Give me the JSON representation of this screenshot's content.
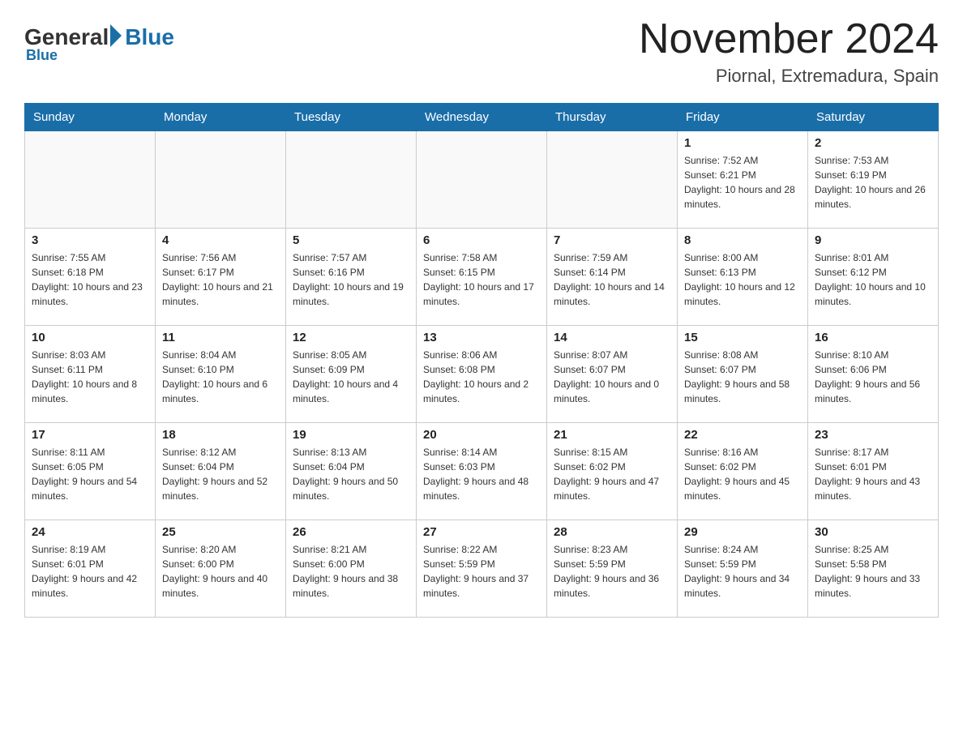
{
  "header": {
    "logo_general": "General",
    "logo_blue": "Blue",
    "title": "November 2024",
    "location": "Piornal, Extremadura, Spain"
  },
  "days_of_week": [
    "Sunday",
    "Monday",
    "Tuesday",
    "Wednesday",
    "Thursday",
    "Friday",
    "Saturday"
  ],
  "weeks": [
    [
      {
        "day": "",
        "info": ""
      },
      {
        "day": "",
        "info": ""
      },
      {
        "day": "",
        "info": ""
      },
      {
        "day": "",
        "info": ""
      },
      {
        "day": "",
        "info": ""
      },
      {
        "day": "1",
        "info": "Sunrise: 7:52 AM\nSunset: 6:21 PM\nDaylight: 10 hours and 28 minutes."
      },
      {
        "day": "2",
        "info": "Sunrise: 7:53 AM\nSunset: 6:19 PM\nDaylight: 10 hours and 26 minutes."
      }
    ],
    [
      {
        "day": "3",
        "info": "Sunrise: 7:55 AM\nSunset: 6:18 PM\nDaylight: 10 hours and 23 minutes."
      },
      {
        "day": "4",
        "info": "Sunrise: 7:56 AM\nSunset: 6:17 PM\nDaylight: 10 hours and 21 minutes."
      },
      {
        "day": "5",
        "info": "Sunrise: 7:57 AM\nSunset: 6:16 PM\nDaylight: 10 hours and 19 minutes."
      },
      {
        "day": "6",
        "info": "Sunrise: 7:58 AM\nSunset: 6:15 PM\nDaylight: 10 hours and 17 minutes."
      },
      {
        "day": "7",
        "info": "Sunrise: 7:59 AM\nSunset: 6:14 PM\nDaylight: 10 hours and 14 minutes."
      },
      {
        "day": "8",
        "info": "Sunrise: 8:00 AM\nSunset: 6:13 PM\nDaylight: 10 hours and 12 minutes."
      },
      {
        "day": "9",
        "info": "Sunrise: 8:01 AM\nSunset: 6:12 PM\nDaylight: 10 hours and 10 minutes."
      }
    ],
    [
      {
        "day": "10",
        "info": "Sunrise: 8:03 AM\nSunset: 6:11 PM\nDaylight: 10 hours and 8 minutes."
      },
      {
        "day": "11",
        "info": "Sunrise: 8:04 AM\nSunset: 6:10 PM\nDaylight: 10 hours and 6 minutes."
      },
      {
        "day": "12",
        "info": "Sunrise: 8:05 AM\nSunset: 6:09 PM\nDaylight: 10 hours and 4 minutes."
      },
      {
        "day": "13",
        "info": "Sunrise: 8:06 AM\nSunset: 6:08 PM\nDaylight: 10 hours and 2 minutes."
      },
      {
        "day": "14",
        "info": "Sunrise: 8:07 AM\nSunset: 6:07 PM\nDaylight: 10 hours and 0 minutes."
      },
      {
        "day": "15",
        "info": "Sunrise: 8:08 AM\nSunset: 6:07 PM\nDaylight: 9 hours and 58 minutes."
      },
      {
        "day": "16",
        "info": "Sunrise: 8:10 AM\nSunset: 6:06 PM\nDaylight: 9 hours and 56 minutes."
      }
    ],
    [
      {
        "day": "17",
        "info": "Sunrise: 8:11 AM\nSunset: 6:05 PM\nDaylight: 9 hours and 54 minutes."
      },
      {
        "day": "18",
        "info": "Sunrise: 8:12 AM\nSunset: 6:04 PM\nDaylight: 9 hours and 52 minutes."
      },
      {
        "day": "19",
        "info": "Sunrise: 8:13 AM\nSunset: 6:04 PM\nDaylight: 9 hours and 50 minutes."
      },
      {
        "day": "20",
        "info": "Sunrise: 8:14 AM\nSunset: 6:03 PM\nDaylight: 9 hours and 48 minutes."
      },
      {
        "day": "21",
        "info": "Sunrise: 8:15 AM\nSunset: 6:02 PM\nDaylight: 9 hours and 47 minutes."
      },
      {
        "day": "22",
        "info": "Sunrise: 8:16 AM\nSunset: 6:02 PM\nDaylight: 9 hours and 45 minutes."
      },
      {
        "day": "23",
        "info": "Sunrise: 8:17 AM\nSunset: 6:01 PM\nDaylight: 9 hours and 43 minutes."
      }
    ],
    [
      {
        "day": "24",
        "info": "Sunrise: 8:19 AM\nSunset: 6:01 PM\nDaylight: 9 hours and 42 minutes."
      },
      {
        "day": "25",
        "info": "Sunrise: 8:20 AM\nSunset: 6:00 PM\nDaylight: 9 hours and 40 minutes."
      },
      {
        "day": "26",
        "info": "Sunrise: 8:21 AM\nSunset: 6:00 PM\nDaylight: 9 hours and 38 minutes."
      },
      {
        "day": "27",
        "info": "Sunrise: 8:22 AM\nSunset: 5:59 PM\nDaylight: 9 hours and 37 minutes."
      },
      {
        "day": "28",
        "info": "Sunrise: 8:23 AM\nSunset: 5:59 PM\nDaylight: 9 hours and 36 minutes."
      },
      {
        "day": "29",
        "info": "Sunrise: 8:24 AM\nSunset: 5:59 PM\nDaylight: 9 hours and 34 minutes."
      },
      {
        "day": "30",
        "info": "Sunrise: 8:25 AM\nSunset: 5:58 PM\nDaylight: 9 hours and 33 minutes."
      }
    ]
  ]
}
